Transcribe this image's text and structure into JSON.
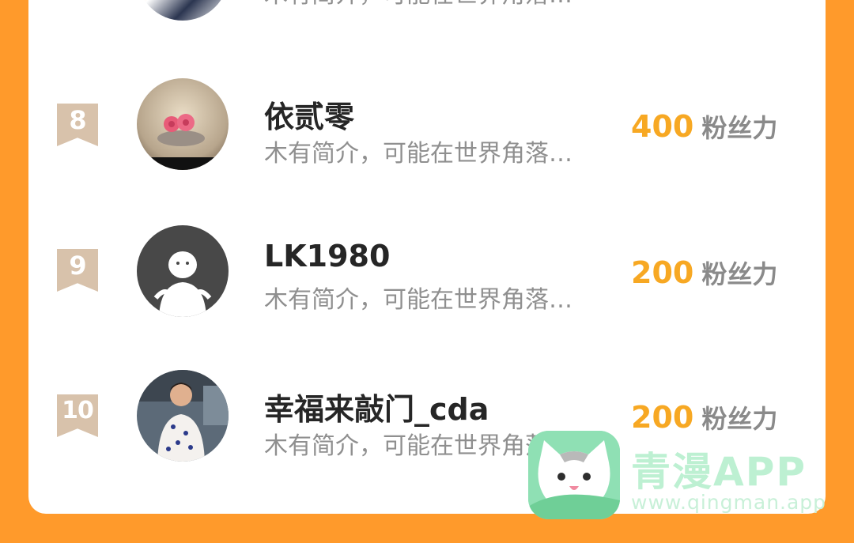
{
  "rows": [
    {
      "rank": "",
      "name": "",
      "bio": "木有简介，可能在世界角落…",
      "fans": "",
      "unit": ""
    },
    {
      "rank": "8",
      "name": "依贰零",
      "bio": "木有简介，可能在世界角落…",
      "fans": "400",
      "unit": "粉丝力"
    },
    {
      "rank": "9",
      "name": "LK1980",
      "bio": "木有简介，可能在世界角落…",
      "fans": "200",
      "unit": "粉丝力"
    },
    {
      "rank": "10",
      "name": "幸福来敲门_cda",
      "bio": "木有简介，可能在世界角落…",
      "fans": "200",
      "unit": "粉丝力"
    }
  ],
  "watermark": {
    "title": "青漫APP",
    "url": "www.qingman.app"
  },
  "colors": {
    "background": "#ff9a2b",
    "fans_number": "#f7a823",
    "rank_badge": "#d8c2ab"
  }
}
